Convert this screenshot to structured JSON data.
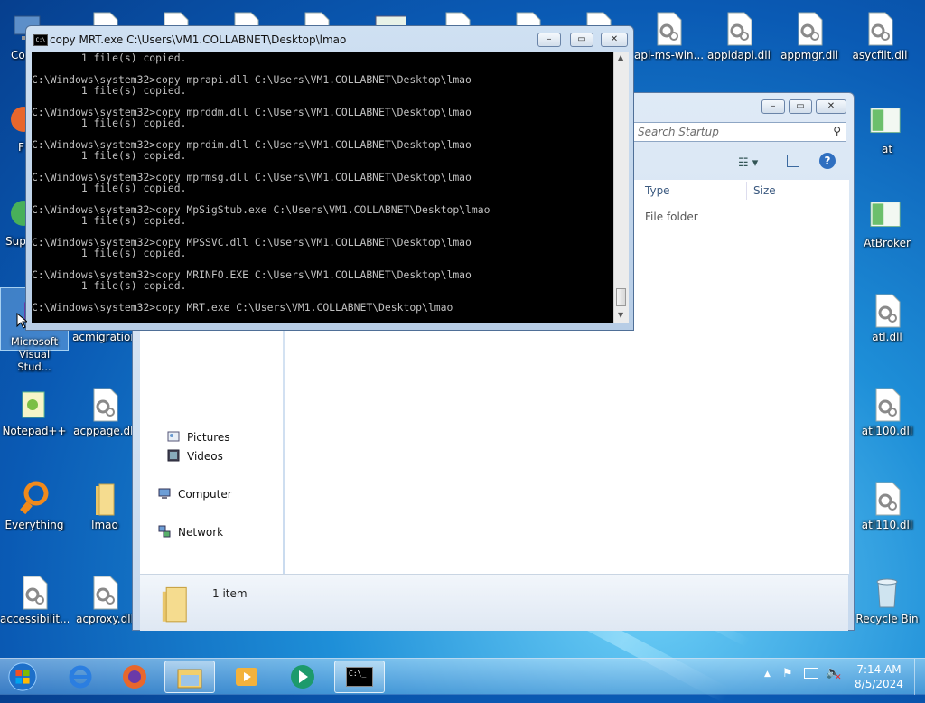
{
  "desktop": {
    "icons": [
      {
        "label": "Co"
      },
      {
        "label": "F"
      },
      {
        "label": "Sup"
      },
      {
        "label": "Microsoft Visual Stud..."
      },
      {
        "label": "acmigration"
      },
      {
        "label": "Notepad++"
      },
      {
        "label": "acppage.dll"
      },
      {
        "label": "Everything"
      },
      {
        "label": "lmao"
      },
      {
        "label": "accessibilit..."
      },
      {
        "label": "acproxy.dll"
      },
      {
        "label": "api-ms-win..."
      },
      {
        "label": "appidapi.dll"
      },
      {
        "label": "appmgr.dll"
      },
      {
        "label": "asycfilt.dll"
      },
      {
        "label": "at"
      },
      {
        "label": "AtBroker"
      },
      {
        "label": "atl.dll"
      },
      {
        "label": "atl100.dll"
      },
      {
        "label": "atl110.dll"
      },
      {
        "label": "Recycle Bin"
      }
    ]
  },
  "explorer": {
    "search_placeholder": "Search Startup",
    "columns": {
      "type": "Type",
      "size": "Size"
    },
    "row": {
      "type": "File folder"
    },
    "nav": {
      "pictures": "Pictures",
      "videos": "Videos",
      "computer": "Computer",
      "network": "Network"
    },
    "details": "1 item"
  },
  "cmd": {
    "title": "copy  MRT.exe C:\\Users\\VM1.COLLABNET\\Desktop\\lmao",
    "lines": [
      "        1 file(s) copied.",
      "",
      "C:\\Windows\\system32>copy mprapi.dll C:\\Users\\VM1.COLLABNET\\Desktop\\lmao",
      "        1 file(s) copied.",
      "",
      "C:\\Windows\\system32>copy mprddm.dll C:\\Users\\VM1.COLLABNET\\Desktop\\lmao",
      "        1 file(s) copied.",
      "",
      "C:\\Windows\\system32>copy mprdim.dll C:\\Users\\VM1.COLLABNET\\Desktop\\lmao",
      "        1 file(s) copied.",
      "",
      "C:\\Windows\\system32>copy mprmsg.dll C:\\Users\\VM1.COLLABNET\\Desktop\\lmao",
      "        1 file(s) copied.",
      "",
      "C:\\Windows\\system32>copy MpSigStub.exe C:\\Users\\VM1.COLLABNET\\Desktop\\lmao",
      "        1 file(s) copied.",
      "",
      "C:\\Windows\\system32>copy MPSSVC.dll C:\\Users\\VM1.COLLABNET\\Desktop\\lmao",
      "        1 file(s) copied.",
      "",
      "C:\\Windows\\system32>copy MRINFO.EXE C:\\Users\\VM1.COLLABNET\\Desktop\\lmao",
      "        1 file(s) copied.",
      "",
      "C:\\Windows\\system32>copy MRT.exe C:\\Users\\VM1.COLLABNET\\Desktop\\lmao"
    ],
    "icon_text": "C:\\"
  },
  "taskbar": {
    "time": "7:14 AM",
    "date": "8/5/2024",
    "cmd_icon_text": "C:\\_"
  },
  "colors": {
    "accent": "#1e8fd8",
    "console_text": "#c0c0c0"
  }
}
